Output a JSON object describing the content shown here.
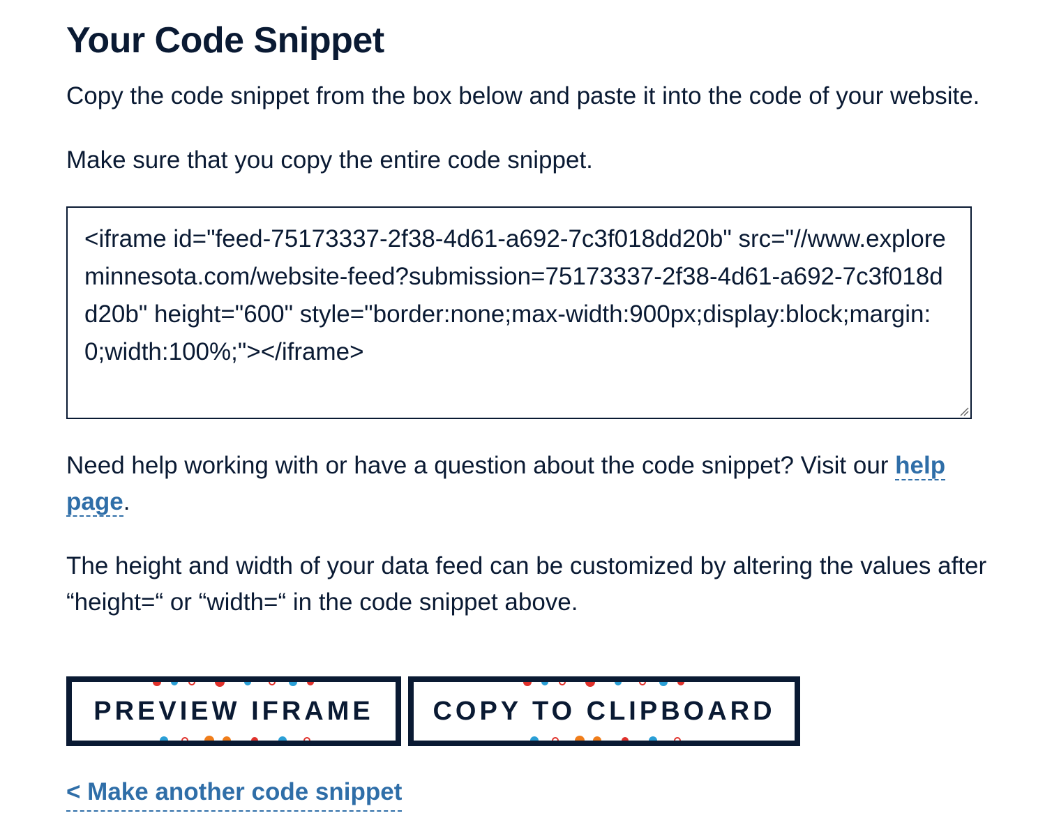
{
  "page": {
    "title": "Your Code Snippet",
    "intro_1": "Copy the code snippet from the box below and paste it into the code of your website.",
    "intro_2": "Make sure that you copy the entire code snippet."
  },
  "snippet": {
    "code": "<iframe id=\"feed-75173337-2f38-4d61-a692-7c3f018dd20b\" src=\"//www.exploreminnesota.com/website-feed?submission=75173337-2f38-4d61-a692-7c3f018dd20b\" height=\"600\" style=\"border:none;max-width:900px;display:block;margin:0;width:100%;\"></iframe>"
  },
  "help": {
    "text_before": "Need help working with or have a question about the code snippet? Visit our ",
    "link_label": "help page",
    "text_after": "."
  },
  "size_note": "The height and width of your data feed can be customized by altering the values after “height=“ or “width=“ in the code snippet above.",
  "buttons": {
    "preview_label": "PREVIEW IFRAME",
    "copy_label": "COPY TO CLIPBOARD"
  },
  "back_link": {
    "label": "< Make another code snippet"
  },
  "colors": {
    "text": "#0a1a33",
    "link": "#2f6ea8",
    "button_border": "#0a1a33",
    "decor_accents": [
      "#e0312b",
      "#2a9fd6",
      "#f07d1a"
    ]
  }
}
